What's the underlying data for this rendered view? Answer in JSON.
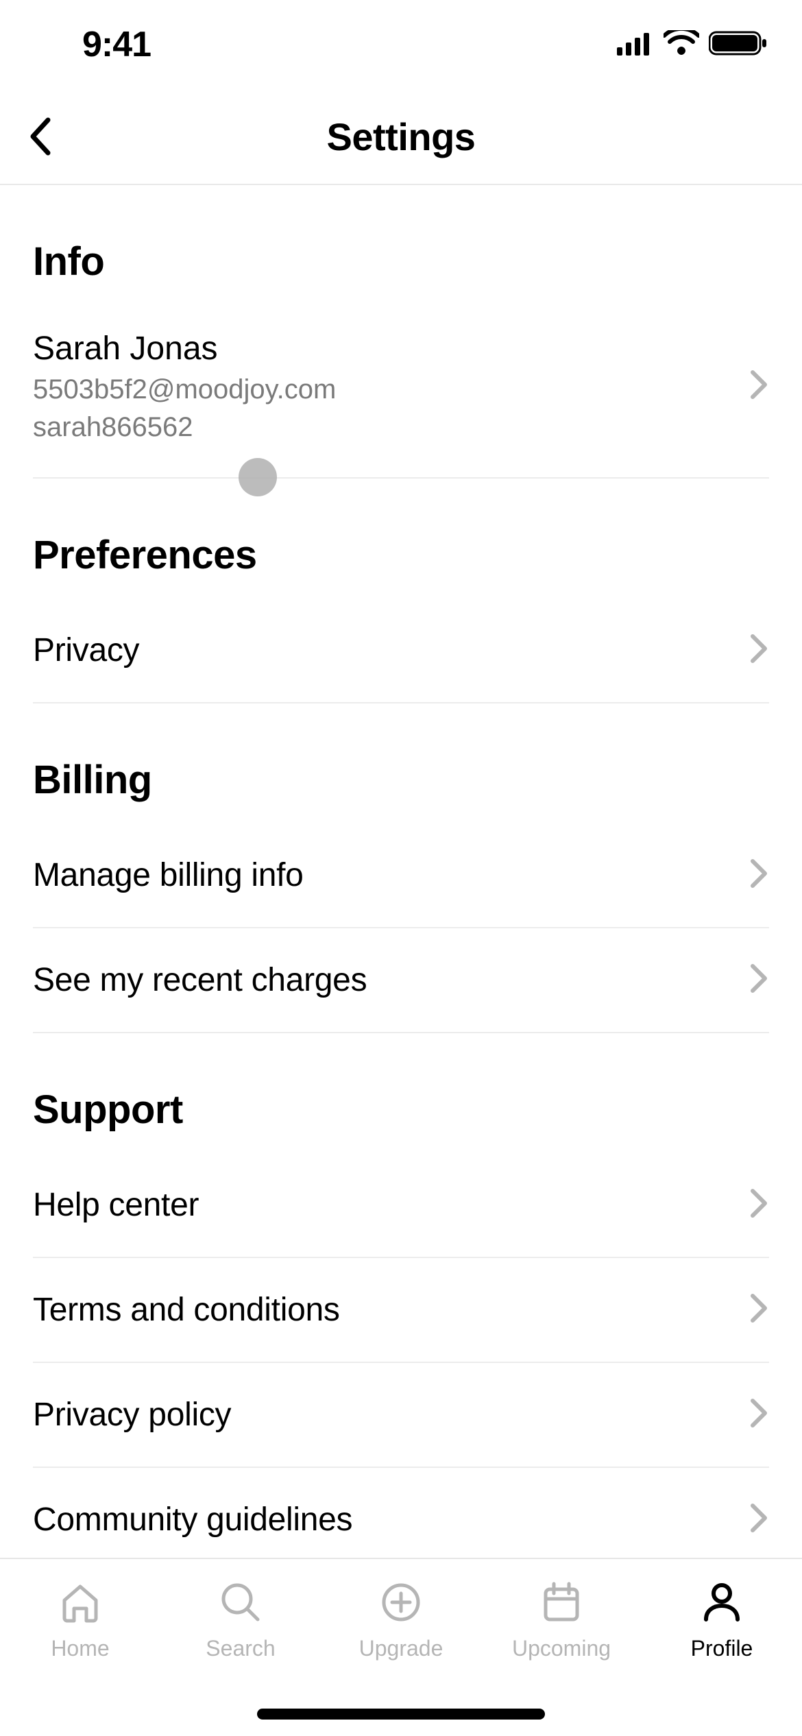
{
  "status": {
    "time": "9:41"
  },
  "header": {
    "title": "Settings"
  },
  "sections": {
    "info": {
      "title": "Info",
      "name": "Sarah Jonas",
      "email": "5503b5f2@moodjoy.com",
      "username": "sarah866562"
    },
    "preferences": {
      "title": "Preferences",
      "items": {
        "privacy": "Privacy"
      }
    },
    "billing": {
      "title": "Billing",
      "items": {
        "manage": "Manage billing info",
        "charges": "See my recent charges"
      }
    },
    "support": {
      "title": "Support",
      "items": {
        "help": "Help center",
        "terms": "Terms and conditions",
        "privacy_policy": "Privacy policy",
        "community": "Community guidelines"
      }
    }
  },
  "tabs": {
    "home": "Home",
    "search": "Search",
    "upgrade": "Upgrade",
    "upcoming": "Upcoming",
    "profile": "Profile"
  }
}
